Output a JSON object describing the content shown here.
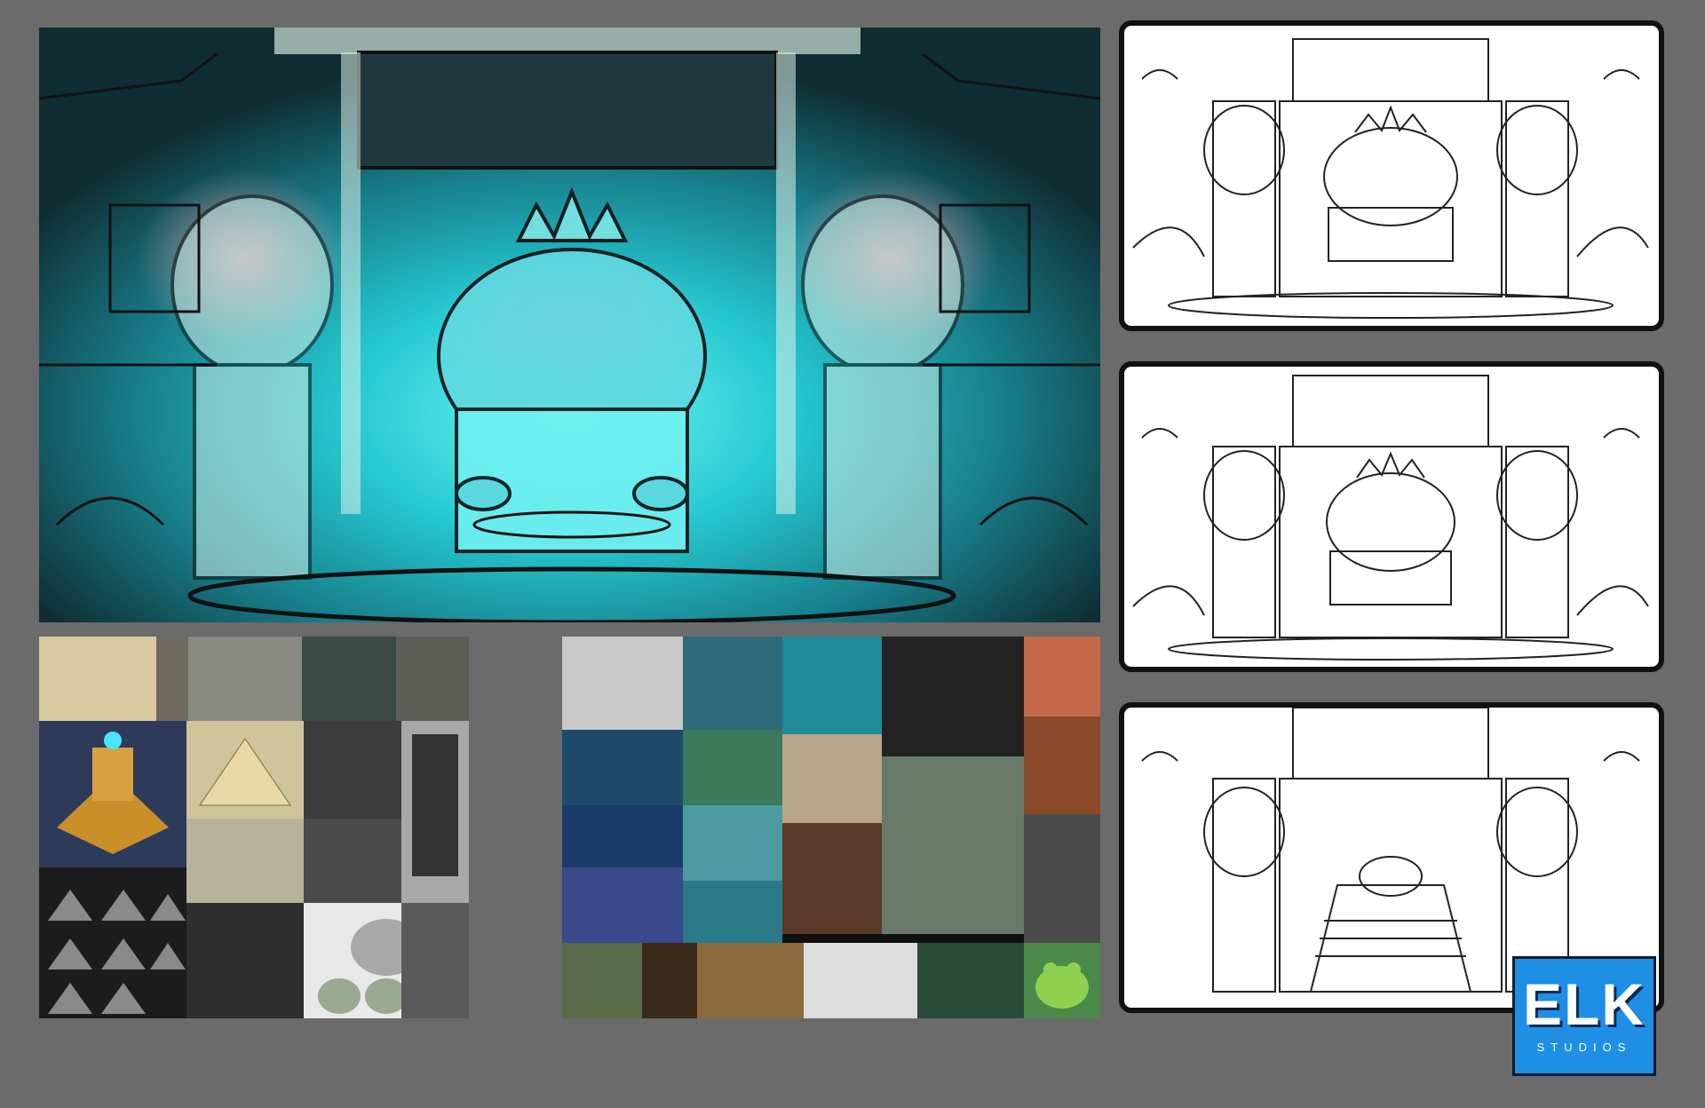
{
  "logo": {
    "brand_main": "ELK",
    "brand_sub": "STUDIOS",
    "color": "#1f8fe6"
  },
  "hero": {
    "palette": {
      "glow": "#33e0e8",
      "dark": "#0f2a2e",
      "pink": "#d98a9a"
    }
  },
  "sketches": [
    {
      "variant": "frog-throne"
    },
    {
      "variant": "frog-throne"
    },
    {
      "variant": "frog-altar"
    }
  ],
  "moodboard_left": {
    "tile_colors": [
      "#d8c9a0",
      "#6f6a60",
      "#8a8a84",
      "#3a4a40",
      "#5d5d58",
      "#8a8a8a",
      "#2d3a5a",
      "#cfc39a",
      "#3c3c3c",
      "#2b2b2b",
      "#b7b39a",
      "#4a4a4a",
      "#1c1c1c",
      "#2e2e2e",
      "#e8e8e8",
      "#a8a8a8",
      "#5a5a5a"
    ]
  },
  "moodboard_right": {
    "tile_colors": [
      "#c9c9c9",
      "#2f6a7a",
      "#1e8a9a",
      "#222",
      "#c46a4a",
      "#1e4a6a",
      "#3a7a5a",
      "#b9a58a",
      "#6a7a6a",
      "#8a4a2a",
      "#1a3a6a",
      "#4a9aa0",
      "#6a4a3a",
      "#3a5a3a",
      "#5a3a2a",
      "#3a4a8a",
      "#2a7a8a",
      "#4a4a4a",
      "#5a6a4a",
      "#7a5a2a",
      "#3a2a1a",
      "#8a6a3a",
      "#ddd",
      "#2a4a3a",
      "#4a8a4a"
    ]
  }
}
